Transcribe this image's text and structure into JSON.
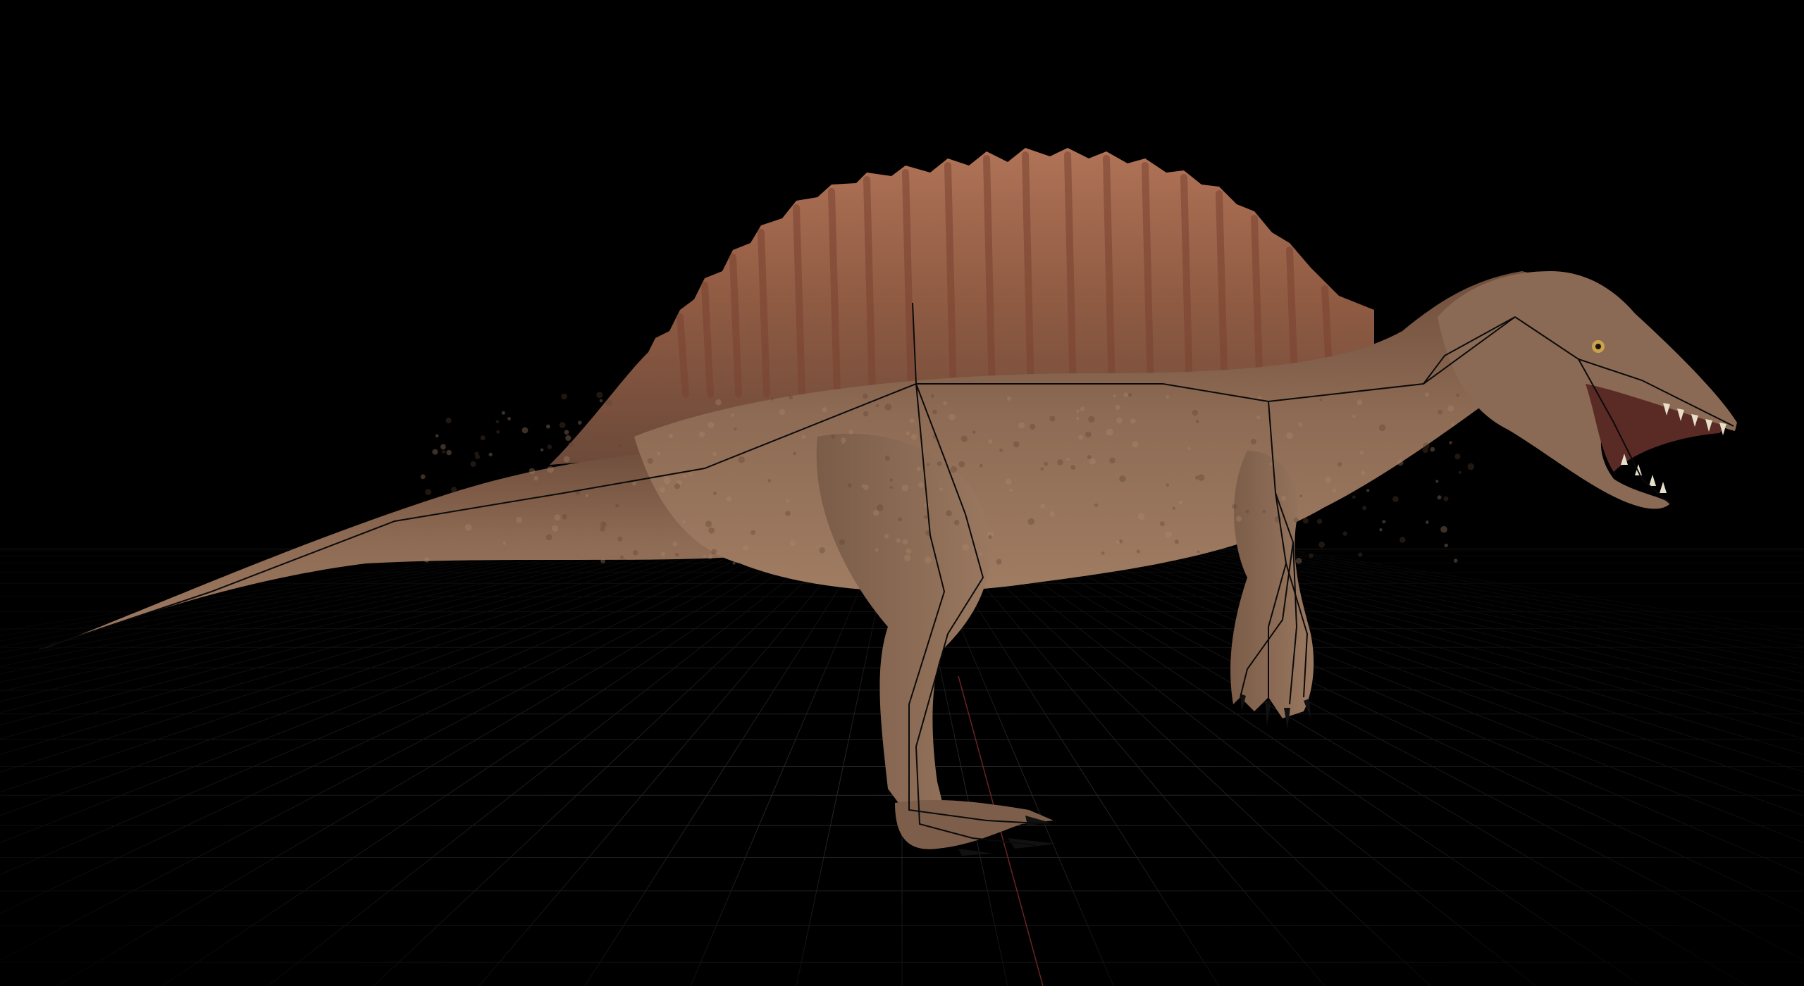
{
  "viewport": {
    "background_color": "#000000",
    "grid_color": "#2a2a2a",
    "axis_color": "#6a2424",
    "rig_bone_color": "#0a0a0a"
  },
  "model": {
    "subject": "spinosaurus",
    "body_color": "#8b6a52",
    "belly_color": "#a27f64",
    "sail_color": "#9c6b4e",
    "sail_accent_color": "#7a4230",
    "claw_color": "#111111",
    "tooth_color": "#e8dfc8",
    "eye_color": "#c9a24a"
  }
}
